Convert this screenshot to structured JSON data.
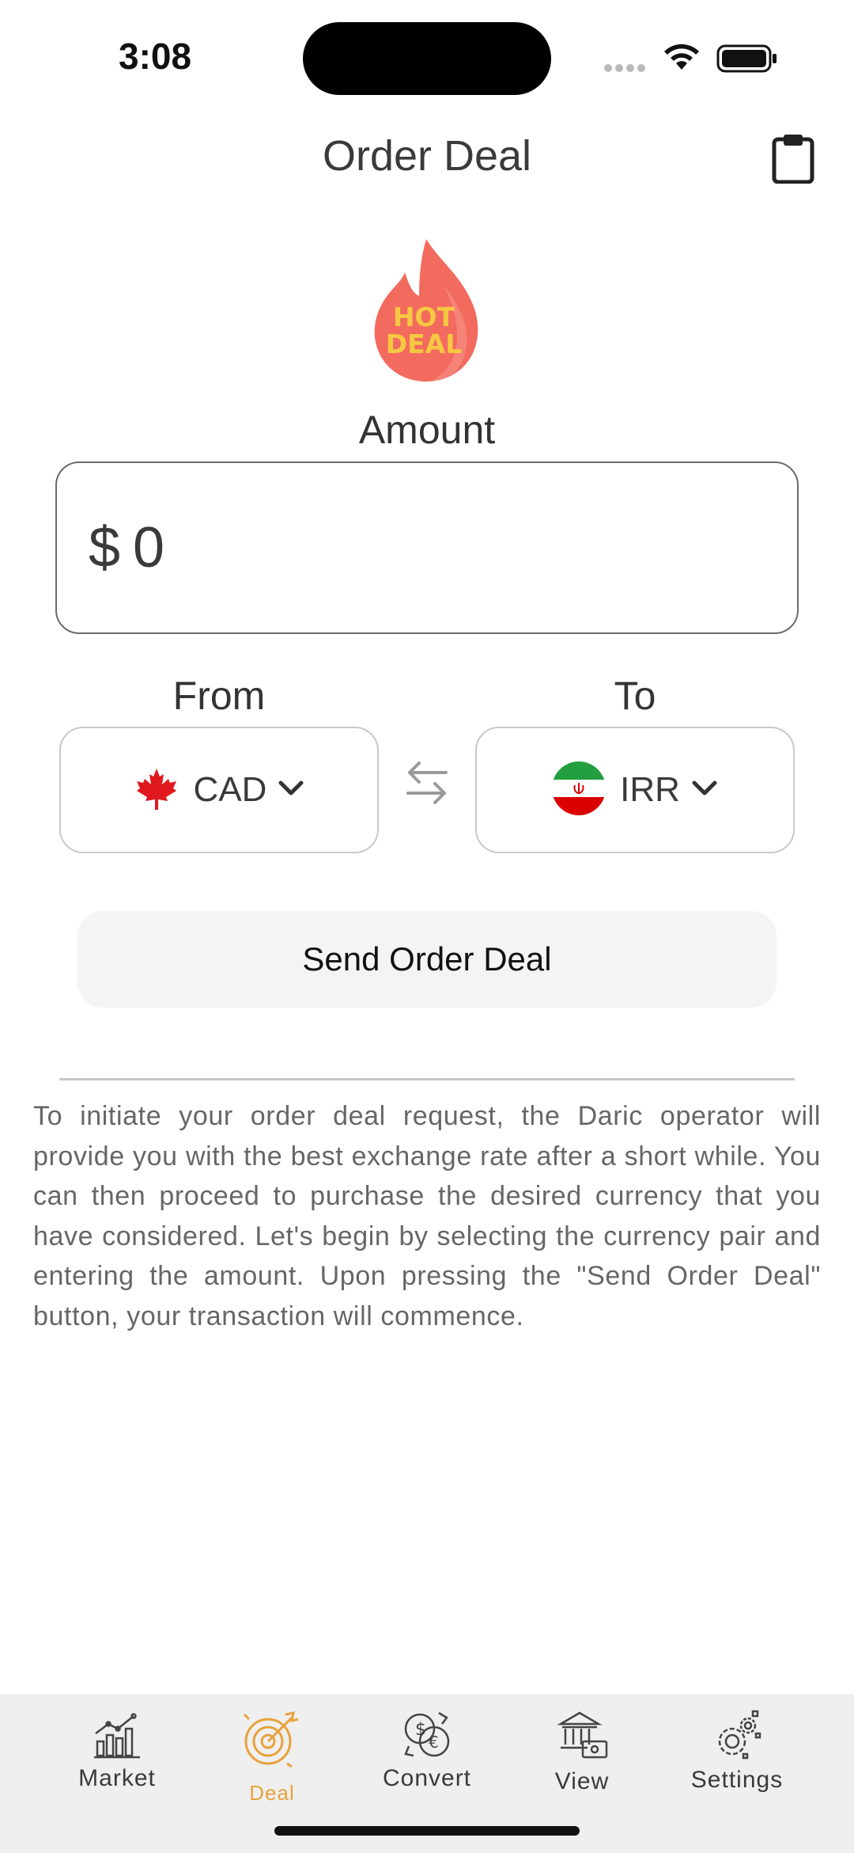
{
  "status_bar": {
    "time": "3:08"
  },
  "header": {
    "title": "Order Deal"
  },
  "hot_deal_badge": {
    "line1": "HOT",
    "line2": "DEAL"
  },
  "amount": {
    "label": "Amount",
    "currency_symbol": "$",
    "value": "0"
  },
  "from": {
    "label": "From",
    "currency": "CAD",
    "flag": "canada-flag-icon"
  },
  "to": {
    "label": "To",
    "currency": "IRR",
    "flag": "iran-flag-icon"
  },
  "send_button": {
    "label": "Send Order Deal"
  },
  "description": "To initiate your order deal request, the Daric operator will provide you with the best exchange rate after a short while. You can then proceed to purchase the desired currency that you have considered. Let's begin by selecting the currency pair and entering the amount. Upon pressing the \"Send Order Deal\" button, your transaction will commence.",
  "tabs": [
    {
      "label": "Market",
      "icon": "market-chart-icon",
      "active": false
    },
    {
      "label": "Deal",
      "icon": "deal-target-icon",
      "active": true
    },
    {
      "label": "Convert",
      "icon": "convert-currency-icon",
      "active": false
    },
    {
      "label": "View",
      "icon": "bank-view-icon",
      "active": false
    },
    {
      "label": "Settings",
      "icon": "settings-gears-icon",
      "active": false
    }
  ],
  "colors": {
    "accent": "#e8a23c",
    "hot_flame": "#f26b5e",
    "hot_text": "#f5c842",
    "canada_red": "#e0191f",
    "iran_green": "#239f40",
    "iran_red": "#da0000"
  }
}
